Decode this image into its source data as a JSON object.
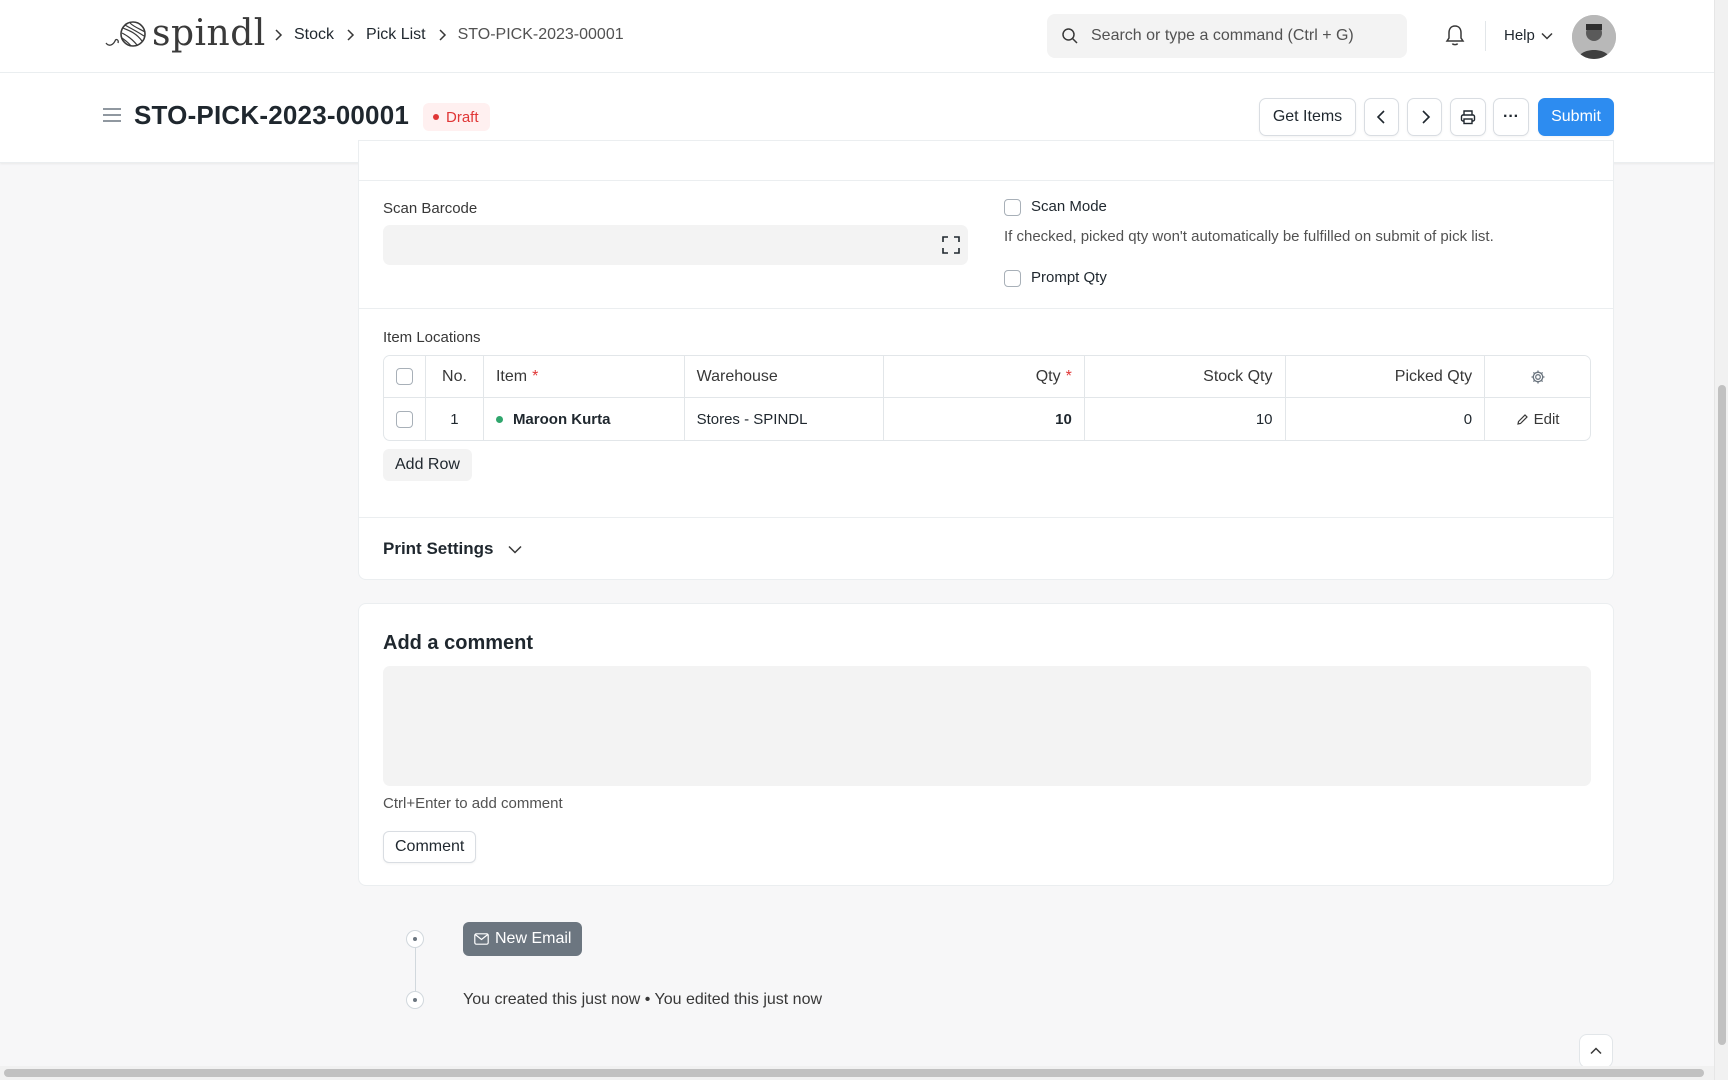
{
  "navbar": {
    "logo_text": "spindl",
    "breadcrumbs": [
      "Stock",
      "Pick List",
      "STO-PICK-2023-00001"
    ],
    "search_placeholder": "Search or type a command (Ctrl + G)",
    "help_label": "Help"
  },
  "page_head": {
    "title": "STO-PICK-2023-00001",
    "status": "Draft",
    "get_items_label": "Get Items",
    "submit_label": "Submit",
    "more_label": "···"
  },
  "form": {
    "scan_barcode_label": "Scan Barcode",
    "scan_mode_label": "Scan Mode",
    "scan_mode_help": "If checked, picked qty won't automatically be fulfilled on submit of pick list.",
    "prompt_qty_label": "Prompt Qty",
    "item_locations_label": "Item Locations",
    "grid": {
      "headers": {
        "no": "No.",
        "item": "Item",
        "warehouse": "Warehouse",
        "qty": "Qty",
        "stock_qty": "Stock Qty",
        "picked_qty": "Picked Qty",
        "required_mark": "*"
      },
      "rows": [
        {
          "no": "1",
          "item": "Maroon Kurta",
          "warehouse": "Stores - SPINDL",
          "qty": "10",
          "stock_qty": "10",
          "picked_qty": "0",
          "edit_label": "Edit"
        }
      ]
    },
    "add_row_label": "Add Row",
    "print_settings_label": "Print Settings"
  },
  "comment": {
    "title": "Add a comment",
    "hint": "Ctrl+Enter to add comment",
    "button_label": "Comment"
  },
  "timeline": {
    "new_email_label": "New Email",
    "activity_text": "You created this just now • You edited this just now"
  },
  "colors": {
    "primary": "#2d8cf0",
    "draft_red": "#e03636",
    "item_status_green": "#30a66d"
  }
}
